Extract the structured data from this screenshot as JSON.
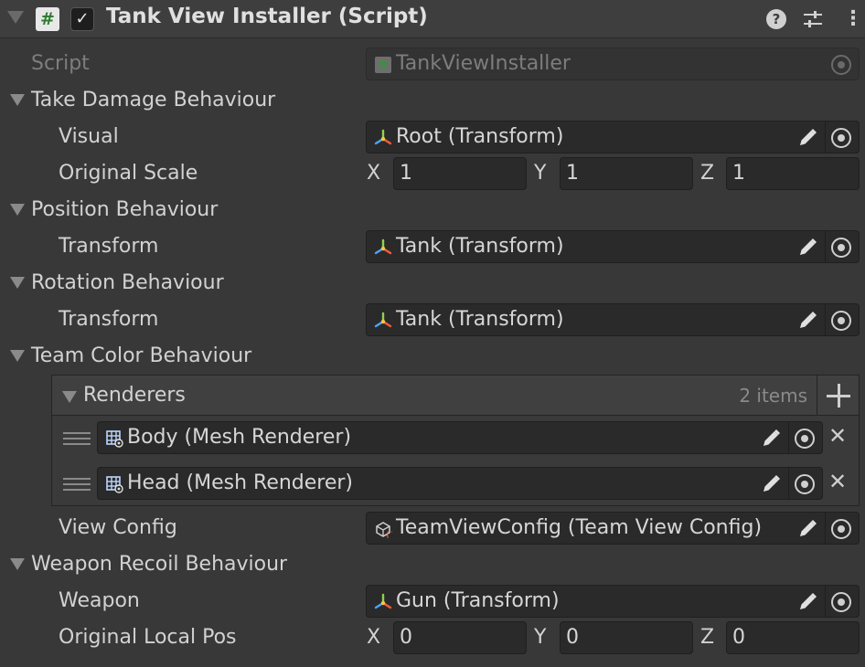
{
  "component": {
    "title": "Tank View Installer (Script)",
    "enabled_glyph": "✓",
    "script_icon_glyph": "#",
    "help_glyph": "?",
    "menu_glyph": "⋮"
  },
  "script": {
    "label": "Script",
    "value": "TankViewInstaller",
    "icon": "script-asset-icon"
  },
  "take_damage": {
    "header": "Take Damage Behaviour",
    "visual": {
      "label": "Visual",
      "value": "Root (Transform)"
    },
    "original_scale": {
      "label": "Original Scale",
      "x_label": "X",
      "y_label": "Y",
      "z_label": "Z",
      "x": "1",
      "y": "1",
      "z": "1"
    }
  },
  "position": {
    "header": "Position Behaviour",
    "transform": {
      "label": "Transform",
      "value": "Tank (Transform)"
    }
  },
  "rotation": {
    "header": "Rotation Behaviour",
    "transform": {
      "label": "Transform",
      "value": "Tank (Transform)"
    }
  },
  "team_color": {
    "header": "Team Color Behaviour",
    "renderers": {
      "label": "Renderers",
      "count": "2 items",
      "items": [
        {
          "value": "Body (Mesh Renderer)"
        },
        {
          "value": "Head (Mesh Renderer)"
        }
      ],
      "remove_glyph": "✕"
    },
    "view_config": {
      "label": "View Config",
      "value": "TeamViewConfig (Team View Config)"
    }
  },
  "weapon_recoil": {
    "header": "Weapon Recoil Behaviour",
    "weapon": {
      "label": "Weapon",
      "value": "Gun (Transform)"
    },
    "original_local_pos": {
      "label": "Original Local Pos",
      "x_label": "X",
      "y_label": "Y",
      "z_label": "Z",
      "x": "0",
      "y": "0",
      "z": "0"
    }
  },
  "colors": {
    "background": "#383838",
    "field": "#2a2a2a",
    "text": "#d2d2d2",
    "disabled_text": "#7d7d7d",
    "script_icon_green": "#2f7d32"
  }
}
